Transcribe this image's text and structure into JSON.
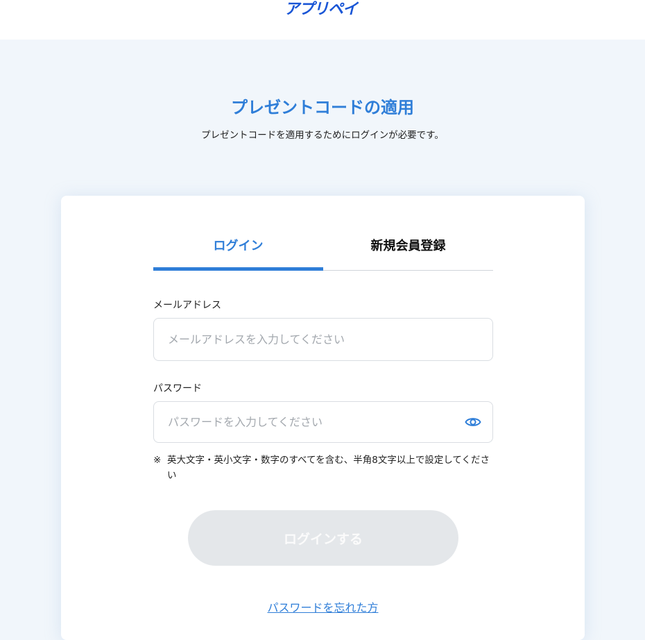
{
  "header": {
    "logo_text": "アプリペイ"
  },
  "page": {
    "title": "プレゼントコードの適用",
    "subtitle": "プレゼントコードを適用するためにログインが必要です。"
  },
  "tabs": {
    "login_label": "ログイン",
    "register_label": "新規会員登録",
    "active": "login"
  },
  "form": {
    "email_label": "メールアドレス",
    "email_placeholder": "メールアドレスを入力してください",
    "email_value": "",
    "password_label": "パスワード",
    "password_placeholder": "パスワードを入力してください",
    "password_value": "",
    "password_toggle_icon": "eye-icon",
    "note_mark": "※",
    "note_text": "英大文字・英小文字・数字のすべてを含む、半角8文字以上で設定してください",
    "submit_label": "ログインする",
    "forgot_link": "パスワードを忘れた方"
  },
  "colors": {
    "accent": "#2f7ed8",
    "logo": "#1a56d6",
    "background": "#f1f6fb",
    "disabled_button": "#e4e7ea"
  }
}
